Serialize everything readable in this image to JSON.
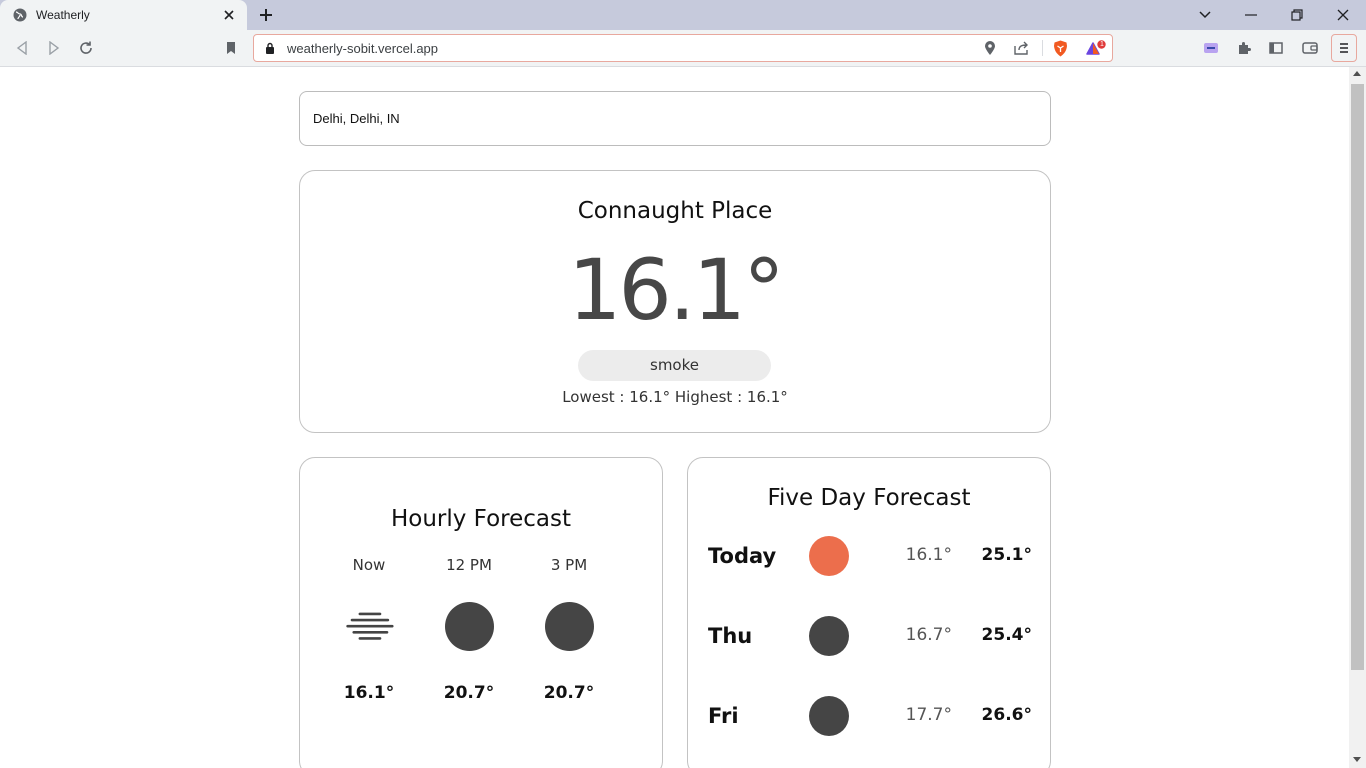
{
  "browser": {
    "tab_title": "Weatherly",
    "url": "weatherly-sobit.vercel.app",
    "notification_count": "1"
  },
  "search": {
    "value": "Delhi, Delhi, IN"
  },
  "current": {
    "location": "Connaught Place",
    "temperature": "16.1°",
    "condition": "smoke",
    "range": "Lowest : 16.1° Highest : 16.1°"
  },
  "hourly": {
    "title": "Hourly Forecast",
    "items": [
      {
        "time": "Now",
        "icon": "fog-icon",
        "temp": "16.1°"
      },
      {
        "time": "12 PM",
        "icon": "dark-circle-icon",
        "temp": "20.7°"
      },
      {
        "time": "3 PM",
        "icon": "dark-circle-icon",
        "temp": "20.7°"
      }
    ]
  },
  "fiveday": {
    "title": "Five Day Forecast",
    "days": [
      {
        "day": "Today",
        "icon": "sun-icon",
        "icon_color": "#ec6e4c",
        "low": "16.1°",
        "high": "25.1°"
      },
      {
        "day": "Thu",
        "icon": "dark-circle-icon",
        "icon_color": "#454545",
        "low": "16.7°",
        "high": "25.4°"
      },
      {
        "day": "Fri",
        "icon": "dark-circle-icon",
        "icon_color": "#454545",
        "low": "17.7°",
        "high": "26.6°"
      }
    ]
  },
  "colors": {
    "accent_sun": "#ec6e4c",
    "dark_icon": "#454545",
    "omnibox_border": "#e8a89e",
    "brave_orange": "#f15a22"
  }
}
